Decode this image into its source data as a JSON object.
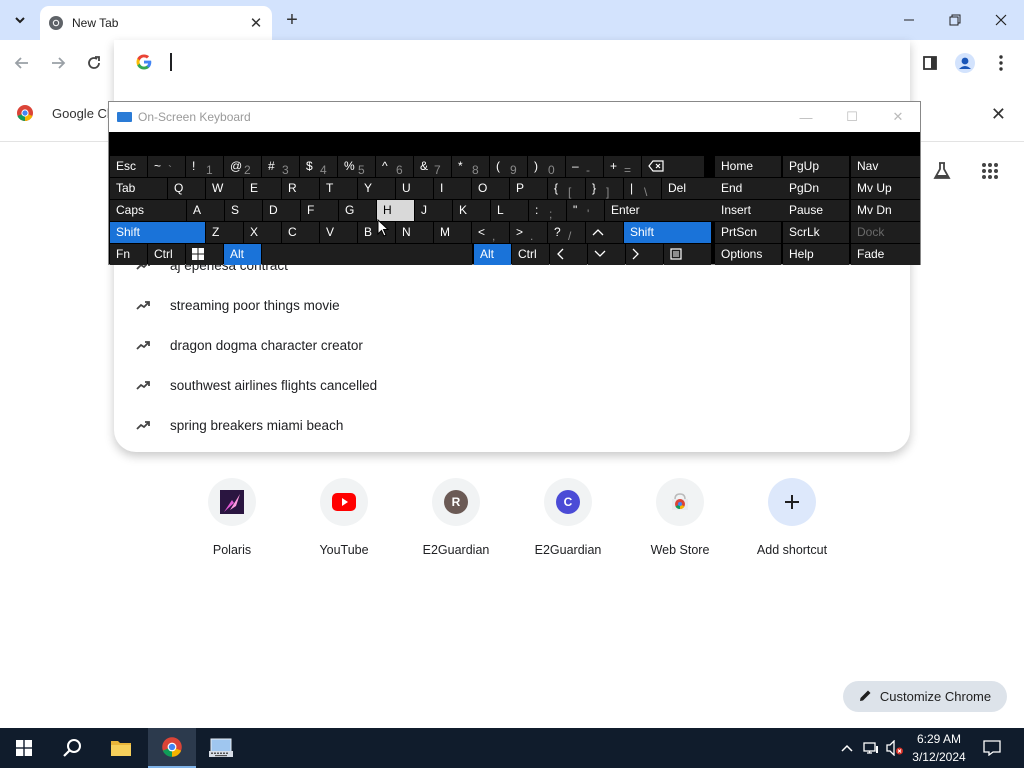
{
  "browser": {
    "tab_title": "New Tab",
    "bookmark_label": "Google Ch"
  },
  "omnibox": {
    "value": "",
    "suggestions": [
      {
        "text": "aj epenesa contract"
      },
      {
        "text": "streaming poor things movie"
      },
      {
        "text": "dragon dogma character creator"
      },
      {
        "text": "southwest airlines flights cancelled"
      },
      {
        "text": "spring breakers miami beach"
      }
    ]
  },
  "shortcuts": [
    {
      "label": "Polaris",
      "icon": "polaris-icon"
    },
    {
      "label": "YouTube",
      "icon": "youtube-icon"
    },
    {
      "label": "E2Guardian",
      "icon": "letter-r",
      "letter": "R",
      "color": "#6b5a55"
    },
    {
      "label": "E2Guardian",
      "icon": "letter-c",
      "letter": "C",
      "color": "#4b4bd6"
    },
    {
      "label": "Web Store",
      "icon": "webstore-icon"
    },
    {
      "label": "Add shortcut",
      "icon": "plus-icon"
    }
  ],
  "customize_label": "Customize Chrome",
  "osk": {
    "title": "On-Screen Keyboard",
    "accent": "#1a73d9",
    "rows": {
      "r1": [
        "Esc",
        "~",
        "`",
        "!",
        "1",
        "@",
        "2",
        "#",
        "3",
        "$",
        "4",
        "%",
        "5",
        "^",
        "6",
        "&",
        "7",
        "*",
        "8",
        "(",
        "9",
        ")",
        "0",
        "–",
        "-",
        "+",
        "="
      ],
      "r2": [
        "Tab",
        "Q",
        "W",
        "E",
        "R",
        "T",
        "Y",
        "U",
        "I",
        "O",
        "P",
        "{",
        "[",
        "}",
        "]",
        "|",
        "\\",
        "Del"
      ],
      "r3": [
        "Caps",
        "A",
        "S",
        "D",
        "F",
        "G",
        "H",
        "J",
        "K",
        "L",
        ":",
        ";",
        "\"",
        "'",
        "Enter"
      ],
      "r4": [
        "Shift",
        "Z",
        "X",
        "C",
        "V",
        "B",
        "N",
        "M",
        "<",
        ",",
        ">",
        ".",
        "?",
        "/",
        "Shift"
      ],
      "r5": [
        "Fn",
        "Ctrl",
        "Alt",
        "Alt",
        "Ctrl"
      ]
    },
    "nav": [
      [
        "Home",
        "PgUp",
        "Nav"
      ],
      [
        "End",
        "PgDn",
        "Mv Up"
      ],
      [
        "Insert",
        "Pause",
        "Mv Dn"
      ],
      [
        "PrtScn",
        "ScrLk",
        "Dock"
      ],
      [
        "Options",
        "Help",
        "Fade"
      ]
    ]
  },
  "taskbar": {
    "time": "6:29 AM",
    "date": "3/12/2024"
  }
}
